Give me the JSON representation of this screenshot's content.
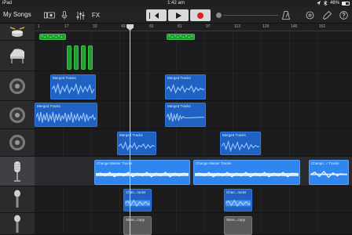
{
  "status": {
    "device": "iPad",
    "time": "1:42 am",
    "battery": "46%"
  },
  "toolbar": {
    "my_songs": "My Songs",
    "fx_label": "FX",
    "icons": [
      "view-toggle-icon",
      "microphone-icon",
      "mixer-icon",
      "fx-label",
      "rewind-icon",
      "play-icon",
      "record-icon",
      "master-volume-icon",
      "metronome-icon",
      "loop-browser-icon",
      "settings-icon",
      "help-icon"
    ]
  },
  "ruler": {
    "ticks": [
      "1",
      "17",
      "33",
      "49",
      "65",
      "81",
      "97",
      "113",
      "129",
      "145",
      "161"
    ]
  },
  "tracks": [
    {
      "instrument": "drums"
    },
    {
      "instrument": "grand-piano"
    },
    {
      "instrument": "speaker"
    },
    {
      "instrument": "speaker"
    },
    {
      "instrument": "speaker"
    },
    {
      "instrument": "condenser-mic",
      "selected": true
    },
    {
      "instrument": "microphone"
    },
    {
      "instrument": "microphone"
    }
  ],
  "regions": {
    "merged_tracks": "Merged Tracks",
    "change_master": "Change Master Tracks",
    "change_master_short": "Change...r Tracks",
    "chan_tracks": "Chan...racks",
    "stereo_copy": "Stere...copy"
  }
}
